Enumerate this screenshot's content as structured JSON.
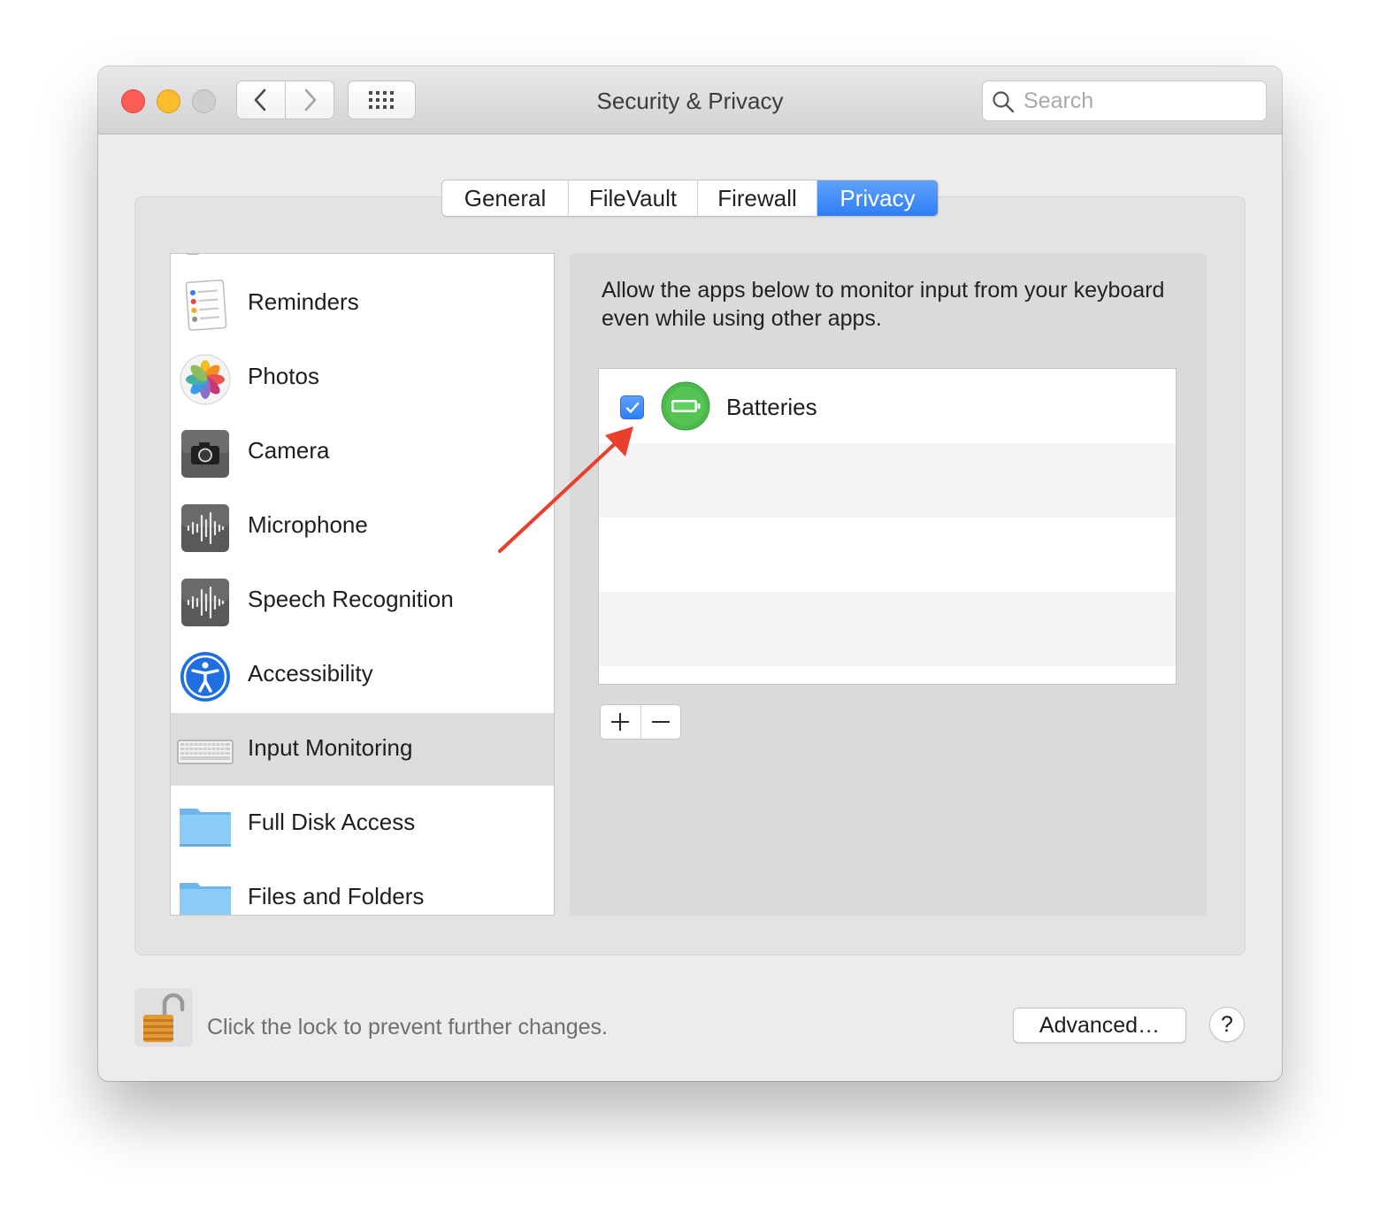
{
  "window": {
    "title": "Security & Privacy",
    "search_placeholder": "Search"
  },
  "tabs": [
    {
      "label": "General",
      "active": false
    },
    {
      "label": "FileVault",
      "active": false
    },
    {
      "label": "Firewall",
      "active": false
    },
    {
      "label": "Privacy",
      "active": true
    }
  ],
  "sidebar": {
    "items": [
      {
        "label": "Reminders",
        "icon": "reminders-icon"
      },
      {
        "label": "Photos",
        "icon": "photos-icon"
      },
      {
        "label": "Camera",
        "icon": "camera-icon"
      },
      {
        "label": "Microphone",
        "icon": "microphone-icon"
      },
      {
        "label": "Speech Recognition",
        "icon": "speech-recognition-icon"
      },
      {
        "label": "Accessibility",
        "icon": "accessibility-icon"
      },
      {
        "label": "Input Monitoring",
        "icon": "keyboard-icon",
        "selected": true
      },
      {
        "label": "Full Disk Access",
        "icon": "folder-icon"
      },
      {
        "label": "Files and Folders",
        "icon": "folder-icon"
      }
    ]
  },
  "detail": {
    "description": "Allow the apps below to monitor input from your keyboard even while using other apps.",
    "apps": [
      {
        "name": "Batteries",
        "checked": true,
        "icon": "battery-icon"
      }
    ],
    "add_label": "+",
    "remove_label": "−"
  },
  "footer": {
    "lock_text": "Click the lock to prevent further changes.",
    "advanced_label": "Advanced…",
    "help_label": "?"
  },
  "colors": {
    "accent": "#2f7ef6",
    "annotation_arrow": "#e8402d",
    "battery_green": "#4cb94c"
  }
}
